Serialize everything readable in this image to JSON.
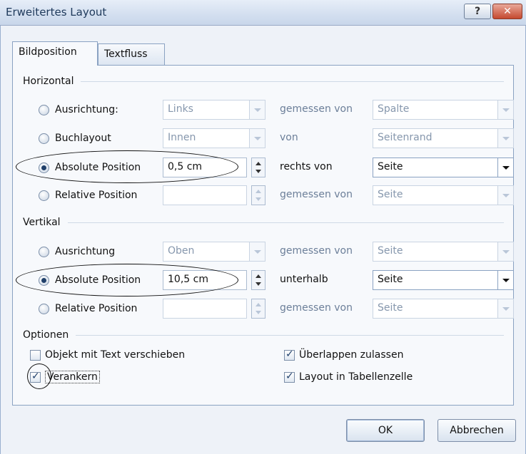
{
  "window": {
    "title": "Erweitertes Layout",
    "help_label": "?",
    "close_label": "✕"
  },
  "tabs": [
    {
      "label": "Bildposition",
      "active": true
    },
    {
      "label": "Textfluss",
      "active": false
    }
  ],
  "horizontal": {
    "group_label": "Horizontal",
    "rows": [
      {
        "option": "Ausrichtung:",
        "checked": false,
        "value": "Links",
        "relation": "gemessen von",
        "reference": "Spalte",
        "enabled": false
      },
      {
        "option": "Buchlayout",
        "checked": false,
        "value": "Innen",
        "relation": "von",
        "reference": "Seitenrand",
        "enabled": false
      },
      {
        "option": "Absolute Position",
        "checked": true,
        "value": "0,5 cm",
        "relation": "rechts von",
        "reference": "Seite",
        "enabled": true
      },
      {
        "option": "Relative Position",
        "checked": false,
        "value": "",
        "relation": "gemessen von",
        "reference": "Seite",
        "enabled": false
      }
    ]
  },
  "vertical": {
    "group_label": "Vertikal",
    "rows": [
      {
        "option": "Ausrichtung",
        "checked": false,
        "value": "Oben",
        "relation": "gemessen von",
        "reference": "Seite",
        "enabled": false
      },
      {
        "option": "Absolute Position",
        "checked": true,
        "value": "10,5 cm",
        "relation": "unterhalb",
        "reference": "Seite",
        "enabled": true
      },
      {
        "option": "Relative Position",
        "checked": false,
        "value": "",
        "relation": "gemessen von",
        "reference": "Seite",
        "enabled": false
      }
    ]
  },
  "options": {
    "group_label": "Optionen",
    "items": [
      {
        "label": "Objekt mit Text verschieben",
        "checked": false
      },
      {
        "label": "Überlappen zulassen",
        "checked": true
      },
      {
        "label": "Verankern",
        "checked": true
      },
      {
        "label": "Layout in Tabellenzelle",
        "checked": true
      }
    ]
  },
  "buttons": {
    "ok": "OK",
    "cancel": "Abbrechen"
  }
}
